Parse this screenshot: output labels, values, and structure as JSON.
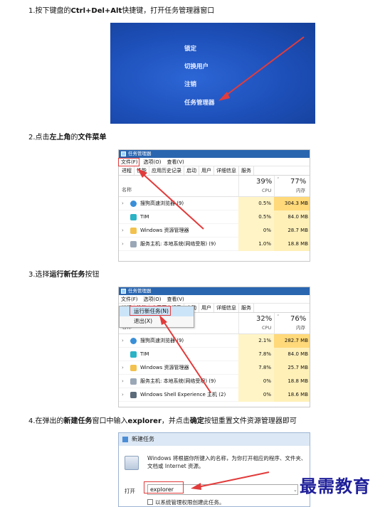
{
  "steps": [
    {
      "prefix": "1.按下键盘的",
      "bold": "Ctrl+Del+Alt",
      "suffix": "快捷键，打开任务管理器窗口"
    },
    {
      "prefix": "2.点击",
      "bold": "左上角",
      "mid": "的",
      "bold2": "文件菜单",
      "suffix": ""
    },
    {
      "prefix": "3.选择",
      "bold": "运行新任务",
      "suffix": "按钮"
    },
    {
      "prefix": "4.在弹出的",
      "bold": "新建任务",
      "mid": "窗口中输入",
      "bold2": "explorer",
      "mid2": "，并点击",
      "bold3": "确定",
      "suffix": "按钮重置文件资源管理器即可"
    }
  ],
  "lock_screen": {
    "items": [
      "锁定",
      "切换用户",
      "注销",
      "任务管理器"
    ],
    "background": "#1d4fb8",
    "arrow_color": "#e23b3b"
  },
  "task_manager": {
    "title": "任务管理器",
    "menu": [
      "文件(F)",
      "选项(O)",
      "查看(V)"
    ],
    "tabs": [
      "进程",
      "性能",
      "应用历史记录",
      "启动",
      "用户",
      "详细信息",
      "服务"
    ],
    "column_name": "名称",
    "cpu_label": "CPU",
    "mem_label": "内存",
    "screen_a": {
      "cpu_pct": "39%",
      "mem_pct": "77%",
      "rows": [
        {
          "name": "搜狗高速浏览器 (9)",
          "cpu": "0.5%",
          "mem": "304.3 MB",
          "icon": "browser-icon"
        },
        {
          "name": "TIM",
          "cpu": "0.5%",
          "mem": "84.0 MB",
          "icon": "tim-icon"
        },
        {
          "name": "Windows 资源管理器",
          "cpu": "0%",
          "mem": "28.7 MB",
          "icon": "folder-icon"
        },
        {
          "name": "服务主机: 本地系统(网络受限) (9)",
          "cpu": "1.0%",
          "mem": "18.8 MB",
          "icon": "service-icon"
        }
      ]
    },
    "screen_b": {
      "cpu_pct": "32%",
      "mem_pct": "76%",
      "dropdown": [
        "运行新任务(N)",
        "退出(X)"
      ],
      "rows": [
        {
          "name": "搜狗高速浏览器 (9)",
          "cpu": "2.1%",
          "mem": "282.7 MB",
          "icon": "browser-icon"
        },
        {
          "name": "TIM",
          "cpu": "7.8%",
          "mem": "84.0 MB",
          "icon": "tim-icon"
        },
        {
          "name": "Windows 资源管理器",
          "cpu": "7.8%",
          "mem": "25.7 MB",
          "icon": "folder-icon"
        },
        {
          "name": "服务主机: 本地系统(网络受限) (9)",
          "cpu": "0%",
          "mem": "18.8 MB",
          "icon": "service-icon"
        },
        {
          "name": "Windows Shell Experience 主机 (2)",
          "cpu": "0%",
          "mem": "18.6 MB",
          "icon": "shell-icon"
        }
      ]
    }
  },
  "run_dialog": {
    "title": "新建任务",
    "description": "Windows 将根据你所键入的名称，为你打开相应的程序、文件夹、文档或 Internet 资源。",
    "open_label": "打开",
    "input_value": "explorer",
    "checkbox_label": "以系统管理权限创建此任务。"
  },
  "watermark": "最需教育",
  "colors": {
    "accent_red": "#e23b3b",
    "titlebar": "#2a66b0",
    "watermark": "#1f1f9a"
  }
}
